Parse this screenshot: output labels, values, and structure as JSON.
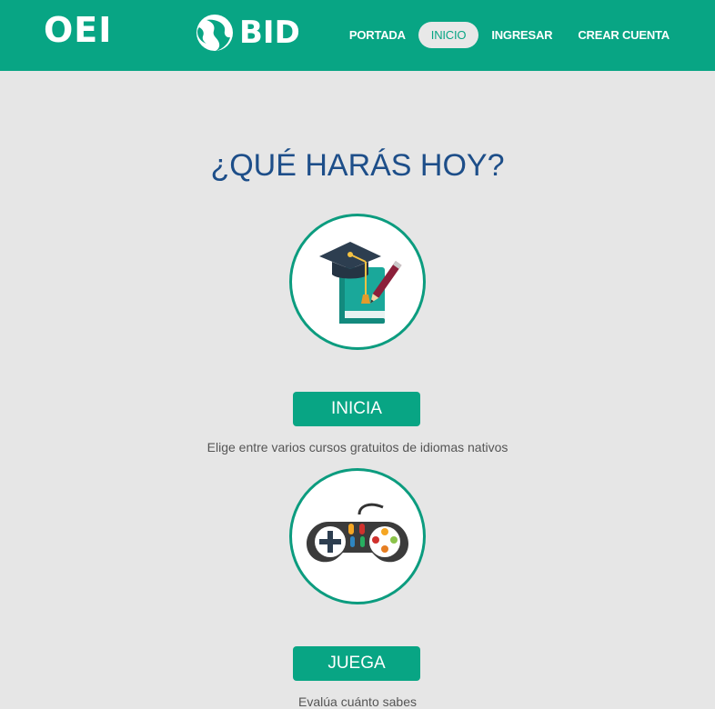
{
  "header": {
    "logo_oei": "OEI",
    "logo_bid": "BID",
    "nav": [
      {
        "label": "PORTADA",
        "active": false
      },
      {
        "label": "INICIO",
        "active": true
      },
      {
        "label": "INGRESAR",
        "active": false
      },
      {
        "label": "CREAR CUENTA",
        "active": false
      }
    ]
  },
  "main": {
    "title": "¿QUÉ HARÁS HOY?",
    "cards": [
      {
        "icon": "graduation-book-icon",
        "button_label": "INICIA",
        "description": "Elige entre varios cursos gratuitos de idiomas nativos"
      },
      {
        "icon": "gamepad-icon",
        "button_label": "JUEGA",
        "description": "Evalúa cuánto sabes"
      }
    ]
  },
  "colors": {
    "brand": "#08a584",
    "background": "#e6e6e6",
    "title": "#1d4e89"
  }
}
